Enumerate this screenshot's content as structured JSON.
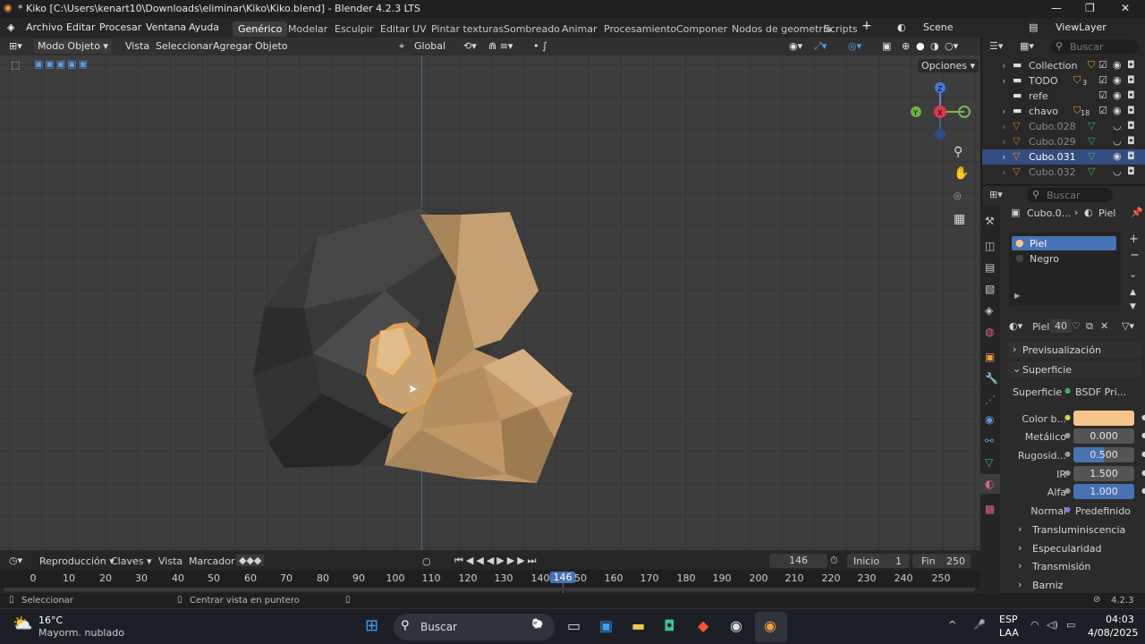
{
  "window": {
    "title": "* Kiko [C:\\Users\\kenart10\\Downloads\\eliminar\\Kiko\\Kiko.blend] - Blender 4.2.3 LTS"
  },
  "menu": {
    "items": [
      "Archivo",
      "Editar",
      "Procesar",
      "Ventana",
      "Ayuda"
    ]
  },
  "workspaces": [
    "Genérico",
    "Modelar",
    "Esculpir",
    "Editar UV",
    "Pintar texturas",
    "Sombreado",
    "Animar",
    "Procesamiento",
    "Componer",
    "Nodos de geometría",
    "Scripts"
  ],
  "scene": {
    "name": "Scene",
    "view_layer": "ViewLayer"
  },
  "viewport_header": {
    "mode": "Modo Objeto",
    "menus": [
      "Vista",
      "Seleccionar",
      "Agregar",
      "Objeto"
    ],
    "orientation": "Global",
    "options": "Opciones"
  },
  "gizmo": {
    "x": "X",
    "y": "Y",
    "z": "Z"
  },
  "outliner": {
    "search_placeholder": "Buscar",
    "items": [
      {
        "name": "Collection",
        "badge": ""
      },
      {
        "name": "TODO",
        "badge": "3"
      },
      {
        "name": "refe",
        "badge": ""
      },
      {
        "name": "chavo",
        "badge": "18"
      },
      {
        "name": "Cubo.028",
        "badge": ""
      },
      {
        "name": "Cubo.029",
        "badge": ""
      },
      {
        "name": "Cubo.031",
        "badge": ""
      },
      {
        "name": "Cubo.032",
        "badge": ""
      }
    ]
  },
  "properties": {
    "search_placeholder": "Buscar",
    "breadcrumb_object": "Cubo.0...",
    "breadcrumb_material": "Piel",
    "slots": [
      "Piel",
      "Negro"
    ],
    "material_name": "Piel",
    "material_users": "40",
    "panels": {
      "preview": "Previsualización",
      "surface": "Superficie"
    },
    "surface_label": "Superficie",
    "surface_value": "BSDF Pri...",
    "fields": [
      {
        "label": "Color b...",
        "value": ""
      },
      {
        "label": "Metálico",
        "value": "0.000"
      },
      {
        "label": "Rugosid...",
        "value": "0.500"
      },
      {
        "label": "IR",
        "value": "1.500"
      },
      {
        "label": "Alfa",
        "value": "1.000"
      },
      {
        "label": "Normal",
        "value": "Predefinido"
      }
    ],
    "subpanels": [
      "Transluminiscencia",
      "Especularidad",
      "Transmisión",
      "Barniz"
    ],
    "base_color": "#f5c48a"
  },
  "timeline": {
    "menus": [
      "Reproducción",
      "Claves",
      "Vista",
      "Marcador"
    ],
    "current_frame": "146",
    "start_label": "Inicio",
    "start": "1",
    "end_label": "Fin",
    "end": "250",
    "ticks": [
      "0",
      "10",
      "20",
      "30",
      "40",
      "50",
      "60",
      "70",
      "80",
      "90",
      "100",
      "110",
      "120",
      "130",
      "140",
      "146",
      "50",
      "160",
      "170",
      "180",
      "190",
      "200",
      "210",
      "220",
      "230",
      "240",
      "250"
    ]
  },
  "status": {
    "select": "Seleccionar",
    "center": "Centrar vista en puntero",
    "version": "4.2.3"
  },
  "taskbar": {
    "temp": "16°C",
    "weather": "Mayorm. nublado",
    "search": "Buscar",
    "lang1": "ESP",
    "lang2": "LAA",
    "time": "04:03",
    "date": "4/08/2025"
  }
}
